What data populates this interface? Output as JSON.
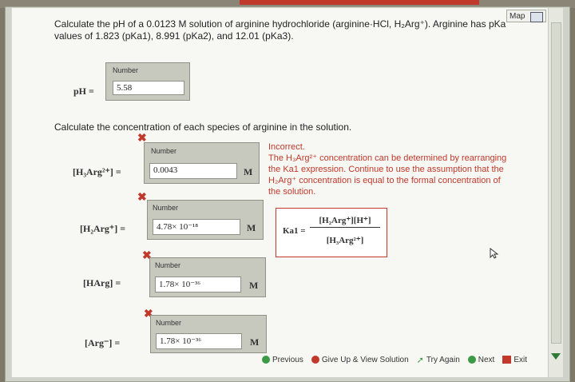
{
  "question": {
    "part1": "Calculate the pH of a 0.0123 M solution of arginine hydrochloride (arginine·HCl, H₂Arg⁺). Arginine has pKa values of 1.823 (pKa1), 8.991 (pKa2), and 12.01 (pKa3).",
    "part2": "Calculate the concentration of each species of arginine in the solution."
  },
  "map_label": "Map",
  "ph": {
    "label": "pH =",
    "caption": "Number",
    "value": "5.58"
  },
  "species": [
    {
      "label": "[H₃Arg²⁺] =",
      "caption": "Number",
      "value": "0.0043",
      "unit": "M",
      "incorrect": true
    },
    {
      "label": "[H₂Arg⁺] =",
      "caption": "Number",
      "value": "4.78× 10⁻¹⁸",
      "unit": "M",
      "incorrect": true
    },
    {
      "label": "[HArg] =",
      "caption": "Number",
      "value": "1.78× 10⁻³⁶",
      "unit": "M",
      "incorrect": true
    },
    {
      "label": "[Arg⁻] =",
      "caption": "Number",
      "value": "1.78× 10⁻³⁶",
      "unit": "M",
      "incorrect": true
    }
  ],
  "feedback": {
    "title": "Incorrect.",
    "text": "The H₃Arg²⁺ concentration can be determined by rearranging the Ka1 expression. Continue to use the assumption that the H₂Arg⁺ concentration is equal to the formal concentration of the solution."
  },
  "equation": {
    "lhs": "Ka1 =",
    "numerator": "[H₂Arg⁺][H⁺]",
    "denominator": "[H₃Arg²⁺]"
  },
  "toolbar": {
    "previous": "Previous",
    "give_up": "Give Up & View Solution",
    "try_again": "Try Again",
    "next": "Next",
    "exit": "Exit"
  },
  "colors": {
    "incorrect": "#c0392b",
    "success_green": "#2d7a36"
  }
}
